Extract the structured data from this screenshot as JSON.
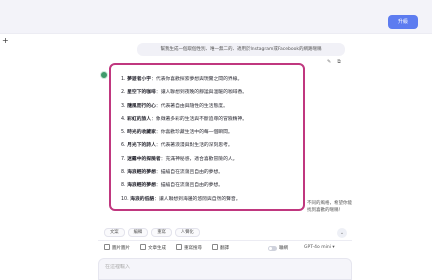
{
  "header": {
    "upgrade_label": "升級"
  },
  "sidebar": {
    "new_chat_glyph": "+"
  },
  "conversation": {
    "user_message": "幫我生成一個取個性別、唯一無二的、適用於Instagram或Facebook的網路暱稱",
    "message_tools": [
      "edit-icon",
      "copy-icon"
    ],
    "answer_items": [
      {
        "num": "1.",
        "name": "夢遊者小宇",
        "desc": "：代表你喜歡探索夢想與現實之間的界線。"
      },
      {
        "num": "2.",
        "name": "星空下的咖啡",
        "desc": "：讓人聯想到夜晚的靜謐與溫暖的咖啡香。"
      },
      {
        "num": "3.",
        "name": "隨風而行的心",
        "desc": "：代表著自由與隨性的生活態度。"
      },
      {
        "num": "4.",
        "name": "彩虹的旅人",
        "desc": "：象徵著多彩的生活與不斷追尋的冒險精神。"
      },
      {
        "num": "5.",
        "name": "時光的收藏家",
        "desc": "：你喜歡珍藏生活中的每一個瞬間。"
      },
      {
        "num": "6.",
        "name": "月光下的詩人",
        "desc": "：代表著浪漫與對生活的深刻思考。"
      },
      {
        "num": "7.",
        "name": "迷霧中的探險者",
        "desc": "：充滿神秘感，適合喜歡冒險的人。"
      },
      {
        "num": "8.",
        "name": "海浪輕的夢想",
        "desc": "：描繪自在流蕩且自由的夢想。"
      },
      {
        "num": "8.",
        "name": "海浪輕的夢想",
        "desc": "：描繪自在流蕩且自由的夢想。"
      },
      {
        "num": "10.",
        "name": "海浪的低語",
        "desc": "：讓人聯想到海邊的悠閒與自然的聲音。"
      }
    ],
    "trailing_text": "不同的風格，希望你能找到喜歡的暱稱！",
    "actions": [
      "文案",
      "編輯",
      "重寫",
      "人聲化"
    ]
  },
  "toolbar": {
    "items": [
      {
        "icon": "image-icon",
        "label": "圖片圖片"
      },
      {
        "icon": "document-icon",
        "label": "文章生成"
      },
      {
        "icon": "search-icon",
        "label": "重寫搜尋"
      },
      {
        "icon": "globe-icon",
        "label": "翻譯"
      }
    ],
    "mode_label": "聯網",
    "model_label": "GPT-4o mini ▾"
  },
  "composer": {
    "placeholder": "在這裡輸入"
  }
}
